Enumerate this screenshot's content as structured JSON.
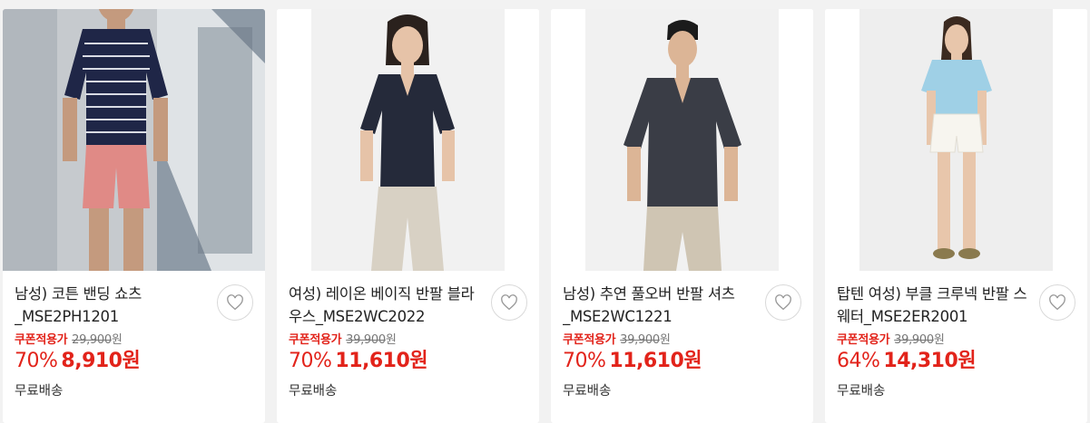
{
  "products": [
    {
      "title": "남성) 코튼 밴딩 쇼츠 _MSE2PH1201",
      "coupon_label": "쿠폰적용가",
      "original_price": "29,900",
      "original_unit": "원",
      "discount_rate": "70%",
      "price": "8,910",
      "price_unit": "원",
      "shipping": "무료배송",
      "image": "man-striped-polo-pink-shorts",
      "colors": {
        "top": "#1f2647",
        "bottom": "#e08a86",
        "bg": "#b7bcc1"
      }
    },
    {
      "title": "여성) 레이온 베이직 반팔 블라우스_MSE2WC2022",
      "coupon_label": "쿠폰적용가",
      "original_price": "39,900",
      "original_unit": "원",
      "discount_rate": "70%",
      "price": "11,610",
      "price_unit": "원",
      "shipping": "무료배송",
      "image": "woman-navy-blouse-beige-pants",
      "colors": {
        "top": "#252a3a",
        "bottom": "#d8d1c4",
        "bg": "#f1f1f1"
      }
    },
    {
      "title": "남성) 추연 풀오버 반팔 셔츠 _MSE2WC1221",
      "coupon_label": "쿠폰적용가",
      "original_price": "39,900",
      "original_unit": "원",
      "discount_rate": "70%",
      "price": "11,610",
      "price_unit": "원",
      "shipping": "무료배송",
      "image": "man-charcoal-shirt-beige-pants",
      "colors": {
        "top": "#3a3d46",
        "bottom": "#cfc5b3",
        "bg": "#f1f1f1"
      }
    },
    {
      "title": "탑텐 여성) 부클 크루넥 반팔 스웨터_MSE2ER2001",
      "coupon_label": "쿠폰적용가",
      "original_price": "39,900",
      "original_unit": "원",
      "discount_rate": "64%",
      "price": "14,310",
      "price_unit": "원",
      "shipping": "무료배송",
      "image": "woman-blue-sweater-white-shorts",
      "colors": {
        "top": "#9fd0e6",
        "bottom": "#f2f0ea",
        "bg": "#eeeeee"
      }
    }
  ],
  "colors": {
    "sale": "#e2231a",
    "muted": "#777777",
    "page_bg": "#f2f2f2"
  }
}
